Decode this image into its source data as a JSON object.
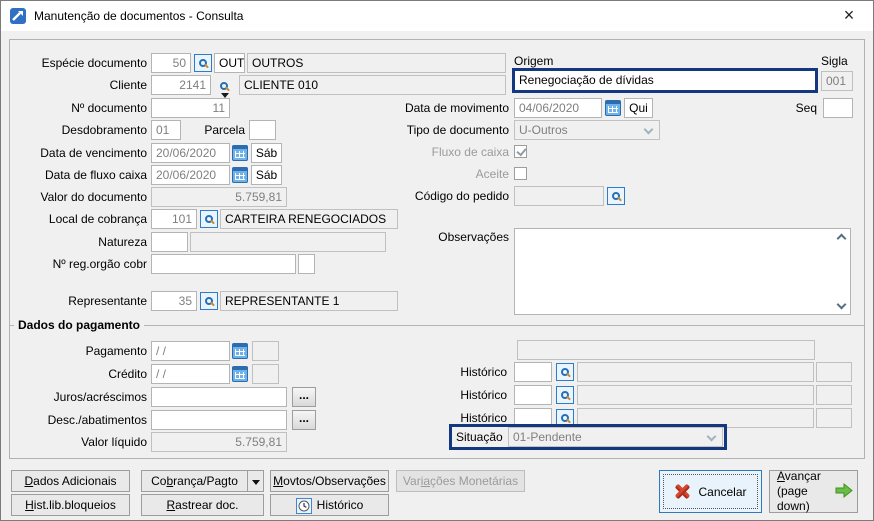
{
  "window": {
    "title": "Manutenção de documentos - Consulta"
  },
  "fields": {
    "especie": {
      "label": "Espécie documento",
      "code": "50",
      "sigla": "OUT",
      "desc": "OUTROS"
    },
    "cliente": {
      "label": "Cliente",
      "code": "2141",
      "desc": "CLIENTE 010"
    },
    "num_documento": {
      "label": "Nº documento",
      "value": "11"
    },
    "desdobramento": {
      "label": "Desdobramento",
      "value": "01"
    },
    "parcela": {
      "label": "Parcela",
      "value": ""
    },
    "data_vencimento": {
      "label": "Data de vencimento",
      "value": "20/06/2020",
      "weekday": "Sáb"
    },
    "data_fluxo_caixa": {
      "label": "Data de fluxo caixa",
      "value": "20/06/2020",
      "weekday": "Sáb"
    },
    "valor_documento": {
      "label": "Valor do documento",
      "value": "5.759,81"
    },
    "local_cobranca": {
      "label": "Local de cobrança",
      "code": "101",
      "desc": "CARTEIRA RENEGOCIADOS"
    },
    "natureza": {
      "label": "Natureza",
      "code": "",
      "desc": ""
    },
    "num_reg_orgao": {
      "label": "Nº reg.orgão cobr",
      "value": "",
      "extra": ""
    },
    "representante": {
      "label": "Representante",
      "code": "35",
      "desc": "REPRESENTANTE 1"
    },
    "origem": {
      "label": "Origem",
      "value": "Renegociação de dívidas"
    },
    "sigla": {
      "label": "Sigla",
      "value": "001"
    },
    "data_movimento": {
      "label": "Data de movimento",
      "value": "04/06/2020",
      "weekday": "Qui"
    },
    "seq": {
      "label": "Seq",
      "value": ""
    },
    "tipo_documento": {
      "label": "Tipo de documento",
      "value": "U-Outros"
    },
    "fluxo_caixa": {
      "label": "Fluxo de caixa",
      "checked": true
    },
    "aceite": {
      "label": "Aceite",
      "checked": false
    },
    "codigo_pedido": {
      "label": "Código do pedido",
      "value": ""
    },
    "observacoes": {
      "label": "Observações",
      "value": ""
    }
  },
  "pagamento": {
    "title": "Dados do pagamento",
    "pagamento": {
      "label": "Pagamento",
      "value": "/  /"
    },
    "credito": {
      "label": "Crédito",
      "value": "/  /"
    },
    "juros": {
      "label": "Juros/acréscimos",
      "value": ""
    },
    "descontos": {
      "label": "Desc./abatimentos",
      "value": ""
    },
    "valor_liquido": {
      "label": "Valor líquido",
      "value": "5.759,81"
    },
    "extra_field": {
      "value": ""
    },
    "historico1": {
      "label": "Histórico",
      "code": "",
      "desc": "",
      "extra": ""
    },
    "historico2": {
      "label": "Histórico",
      "code": "",
      "desc": "",
      "extra": ""
    },
    "historico3": {
      "label": "Histórico",
      "code": "",
      "desc": "",
      "extra": ""
    },
    "situacao": {
      "label": "Situação",
      "value": "01-Pendente"
    }
  },
  "buttons": {
    "ellipsis": "...",
    "dados_adicionais": {
      "pre": "",
      "key": "D",
      "post": "ados Adicionais"
    },
    "cobranca_pagto": {
      "pre": "Co",
      "key": "b",
      "post": "rança/Pagto"
    },
    "movtos_observacoes": {
      "pre": "",
      "key": "M",
      "post": "ovtos/Observações"
    },
    "variacoes_monetarias": {
      "pre": "Var",
      "key": "ia",
      "post": "ções Monetárias"
    },
    "hist_lib_bloqueios": {
      "pre": "",
      "key": "H",
      "post": "ist.lib.bloqueios"
    },
    "rastrear_doc": {
      "pre": "",
      "key": "R",
      "post": "astrear doc."
    },
    "historico": {
      "label": "Histórico"
    },
    "cancelar": {
      "label": "Cancelar"
    },
    "avancar": {
      "pre": "",
      "key": "A",
      "post": "vançar",
      "line2": "(page down)"
    }
  },
  "colors": {
    "highlight": "#14387f",
    "accent_blue": "#2e7cc7",
    "cancel_red": "#d6452e",
    "forward_green": "#6abe45"
  }
}
